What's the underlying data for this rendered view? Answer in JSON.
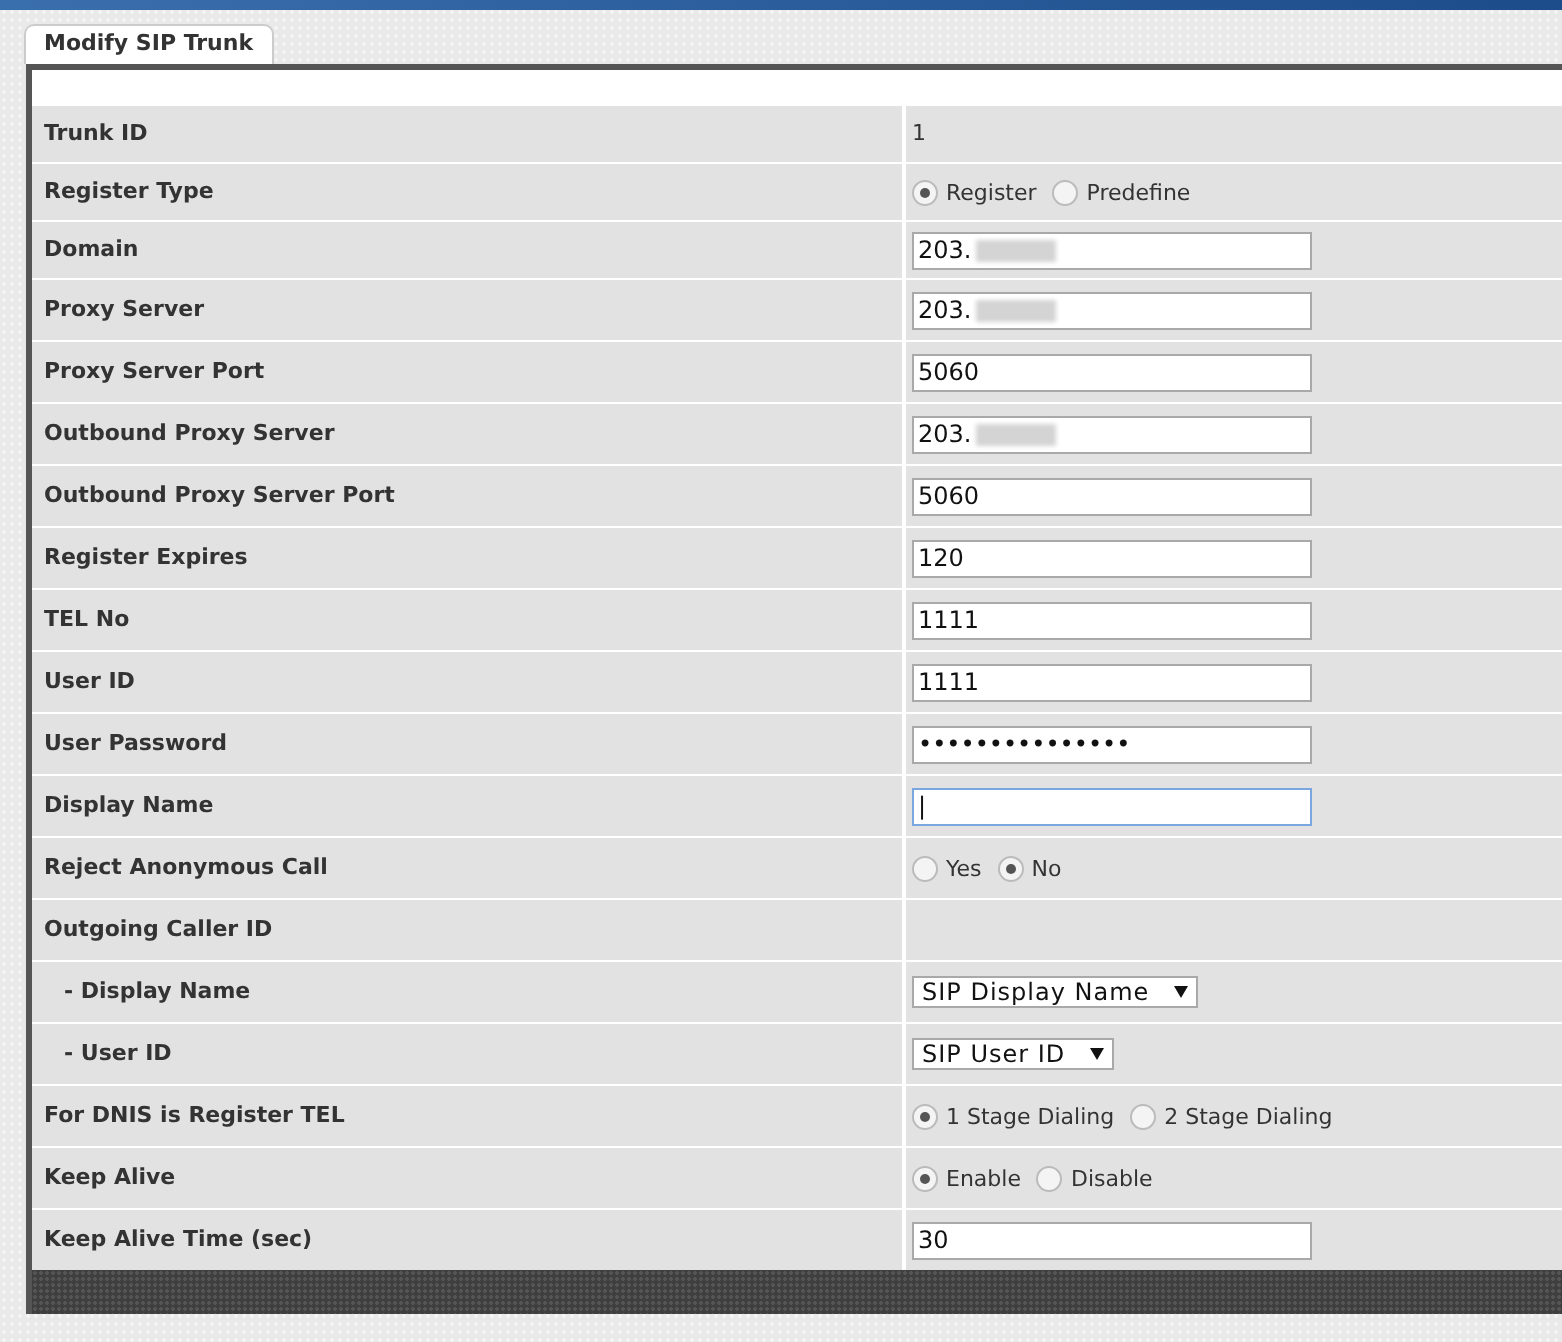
{
  "tab": {
    "label": "Modify SIP Trunk",
    "selected": true
  },
  "rows": [
    {
      "label": "Trunk ID",
      "kind": "text",
      "value": "1"
    },
    {
      "label": "Register Type",
      "kind": "radio",
      "options": [
        {
          "label": "Register",
          "selected": true
        },
        {
          "label": "Predefine",
          "selected": false
        }
      ]
    },
    {
      "label": "Domain",
      "kind": "input",
      "value": "203.",
      "redacted": true,
      "focused": false
    },
    {
      "label": "Proxy Server",
      "kind": "input",
      "value": "203.",
      "redacted": true,
      "focused": false
    },
    {
      "label": "Proxy Server Port",
      "kind": "input",
      "value": "5060",
      "focused": false
    },
    {
      "label": "Outbound Proxy Server",
      "kind": "input",
      "value": "203.",
      "redacted": true,
      "focused": false
    },
    {
      "label": "Outbound Proxy Server Port",
      "kind": "input",
      "value": "5060",
      "focused": false
    },
    {
      "label": "Register Expires",
      "kind": "input",
      "value": "120",
      "focused": false
    },
    {
      "label": "TEL No",
      "kind": "input",
      "value": "1111",
      "focused": false
    },
    {
      "label": "User ID",
      "kind": "input",
      "value": "1111",
      "focused": false
    },
    {
      "label": "User Password",
      "kind": "input",
      "value": "•••••••••••••••",
      "focused": false
    },
    {
      "label": "Display Name",
      "kind": "input",
      "value": "|",
      "focused": true
    },
    {
      "label": "Reject Anonymous Call",
      "kind": "radio",
      "options": [
        {
          "label": "Yes",
          "selected": false
        },
        {
          "label": "No",
          "selected": true
        }
      ]
    },
    {
      "label": "Outgoing Caller ID",
      "kind": "blank",
      "children": [
        {
          "label": "- Display Name",
          "kind": "select",
          "value": "SIP Display Name"
        },
        {
          "label": "- User ID",
          "kind": "select",
          "value": "SIP User ID"
        }
      ]
    },
    {
      "label": "For DNIS is Register TEL",
      "kind": "radio",
      "options": [
        {
          "label": "1 Stage Dialing",
          "selected": true
        },
        {
          "label": "2 Stage Dialing",
          "selected": false
        }
      ]
    },
    {
      "label": "Keep Alive",
      "kind": "radio",
      "options": [
        {
          "label": "Enable",
          "selected": true
        },
        {
          "label": "Disable",
          "selected": false
        }
      ]
    },
    {
      "label": "Keep Alive Time (sec)",
      "kind": "input",
      "value": "30",
      "focused": false
    }
  ]
}
